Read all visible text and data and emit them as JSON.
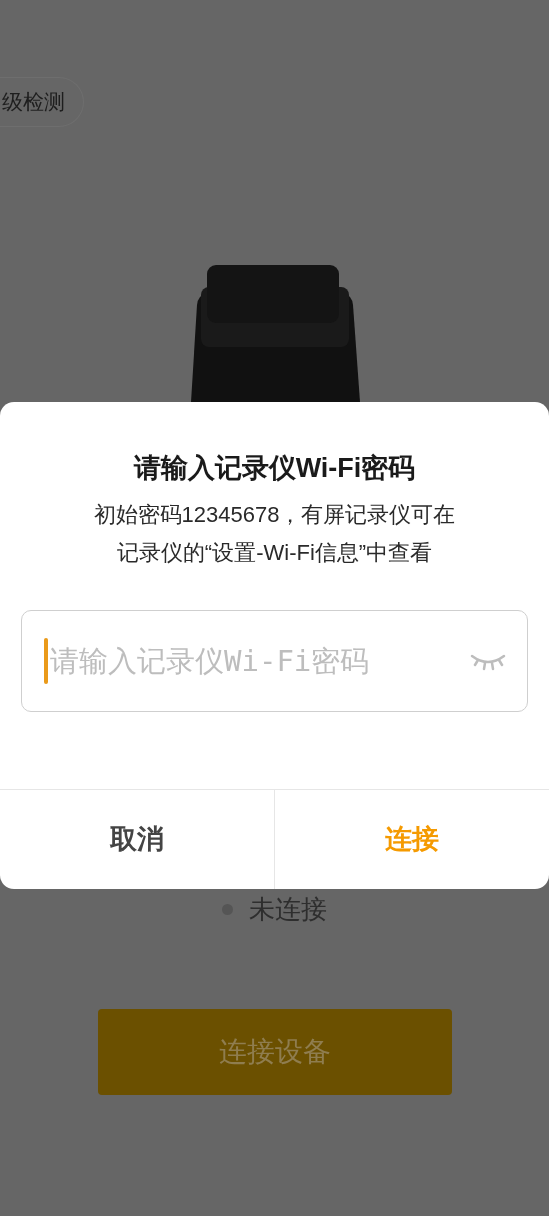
{
  "page": {
    "upgrade_button": "级检测",
    "status": {
      "text": "未连接",
      "connected": false
    },
    "connect_button": "连接设备"
  },
  "dialog": {
    "title": "请输入记录仪Wi-Fi密码",
    "description": [
      "初始密码12345678，有屏记录仪可在",
      "记录仪的“设置-Wi-Fi信息”中查看"
    ],
    "password_field": {
      "placeholder": "请输入记录仪Wi-Fi密码",
      "focused": true,
      "password_visible": false
    },
    "buttons": [
      {
        "label": "取消",
        "kind": "cancel"
      },
      {
        "label": "连接",
        "kind": "confirm"
      }
    ]
  }
}
